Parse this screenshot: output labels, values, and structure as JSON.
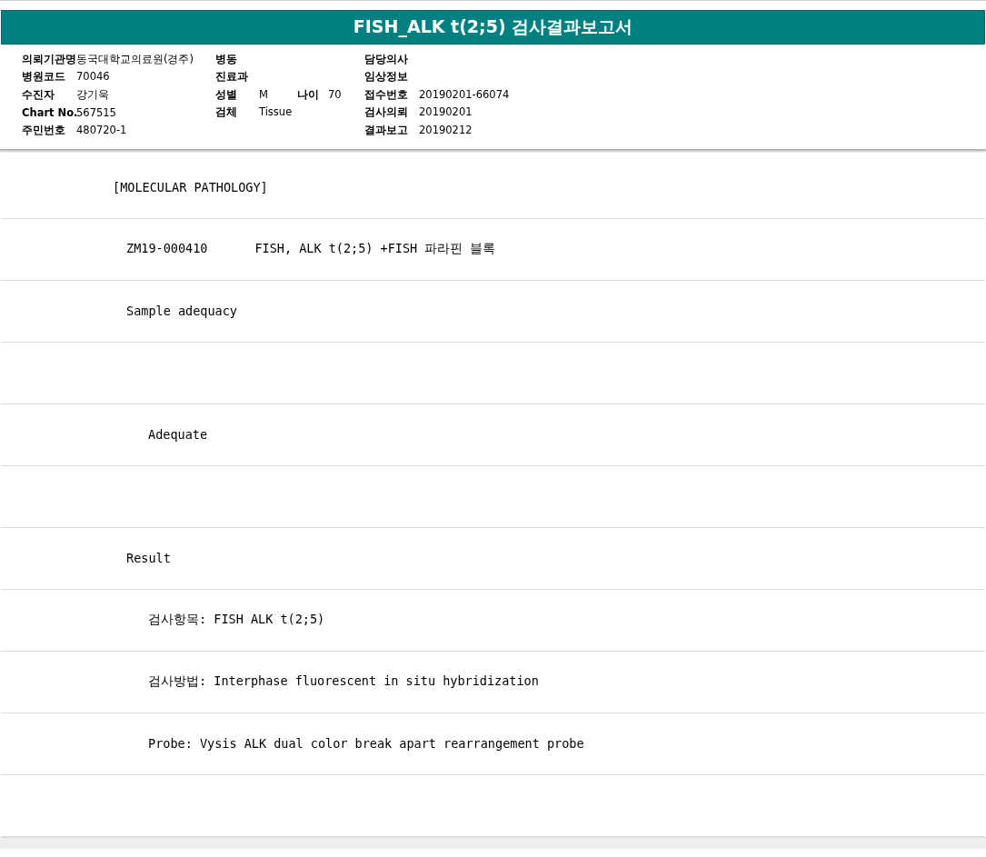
{
  "title": "FISH_ALK t(2;5) 검사결과보고서",
  "info_columns": [
    {
      "rows": [
        [
          {
            "label": "의뢰기관명",
            "value": "동국대학교의료원(경주)"
          }
        ],
        [
          {
            "label": "병원코드",
            "value": "70046"
          }
        ],
        [
          {
            "label": "수진자",
            "value": "강기욱"
          }
        ],
        [
          {
            "label": "Chart No.",
            "value": "567515"
          }
        ],
        [
          {
            "label": "주민번호",
            "value": "480720-1"
          }
        ]
      ]
    },
    {
      "rows": [
        [
          {
            "label": "병동"
          }
        ],
        [
          {
            "label": "진료과"
          }
        ],
        [
          {
            "label": "성별",
            "value": "M"
          },
          {
            "label": "나이",
            "value": "70"
          }
        ],
        [
          {
            "label": "검체",
            "value": "Tissue"
          }
        ]
      ]
    },
    {
      "rows": [
        [
          {
            "label": "담당의사"
          }
        ],
        [
          {
            "label": "임상정보"
          }
        ],
        [
          {
            "label": "접수번호",
            "value": "20190201-66074"
          }
        ],
        [
          {
            "label": "검사의뢰",
            "value": "20190201"
          }
        ],
        [
          {
            "label": "결과보고",
            "value": "20190212"
          }
        ]
      ]
    }
  ],
  "report": [
    {
      "kind": "text",
      "text": "[MOLECULAR PATHOLOGY]",
      "children": [
        {
          "kind": "order",
          "code": "ZM19-000410",
          "name": "FISH, ALK t(2;5) +FISH 파라핀 블록"
        },
        {
          "kind": "text",
          "text": "Sample adequacy",
          "children": [
            {
              "kind": "blank"
            },
            {
              "kind": "text",
              "text": "Adequate"
            },
            {
              "kind": "blank"
            }
          ]
        },
        {
          "kind": "text",
          "text": "Result",
          "children": [
            {
              "kind": "text",
              "text": "검사항목: FISH ALK t(2;5)"
            },
            {
              "kind": "text",
              "text": "검사방법: Interphase fluorescent in situ hybridization"
            },
            {
              "kind": "text",
              "text": "Probe: Vysis ALK dual color break apart rearrangement probe"
            },
            {
              "kind": "blank"
            }
          ]
        }
      ]
    }
  ]
}
